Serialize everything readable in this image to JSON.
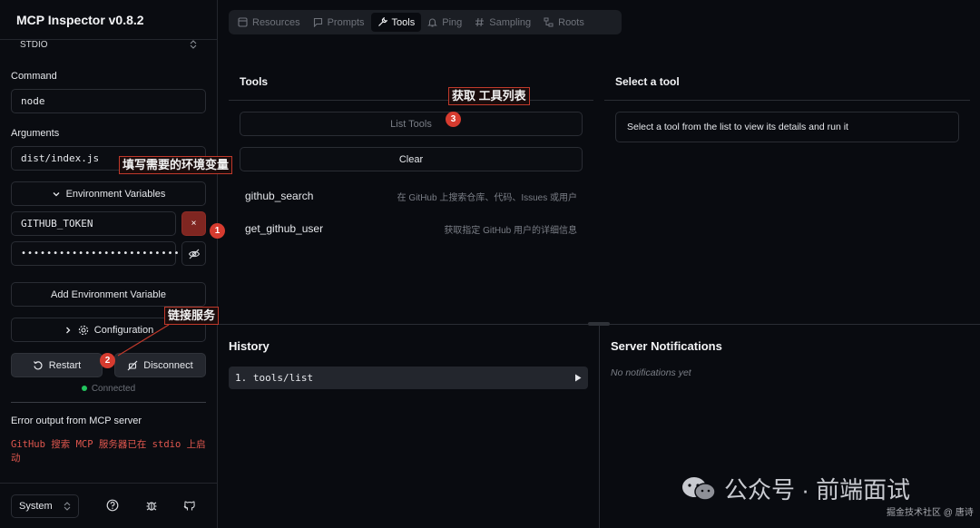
{
  "app": {
    "title": "MCP Inspector v0.8.2"
  },
  "sidebar": {
    "transport": "STDIO",
    "command_label": "Command",
    "command_value": "node",
    "arguments_label": "Arguments",
    "arguments_value": "dist/index.js",
    "env_toggle": "Environment Variables",
    "env_key": "GITHUB_TOKEN",
    "env_remove": "×",
    "env_value": "••••••••••••••••••••••••••••",
    "add_env": "Add Environment Variable",
    "configuration": "Configuration",
    "restart": "Restart",
    "disconnect": "Disconnect",
    "status": "Connected",
    "error_title": "Error output from MCP server",
    "error_text": "GitHub 搜索 MCP 服务器已在 stdio 上启动",
    "theme": "System"
  },
  "tabs": [
    {
      "label": "Resources",
      "icon": "resources-icon"
    },
    {
      "label": "Prompts",
      "icon": "prompts-icon"
    },
    {
      "label": "Tools",
      "icon": "tools-icon",
      "active": true
    },
    {
      "label": "Ping",
      "icon": "bell-icon"
    },
    {
      "label": "Sampling",
      "icon": "hash-icon"
    },
    {
      "label": "Roots",
      "icon": "roots-icon"
    }
  ],
  "tools_panel": {
    "title": "Tools",
    "list_button": "List Tools",
    "clear_button": "Clear",
    "tools": [
      {
        "name": "github_search",
        "description": "在 GitHub 上搜索仓库、代码、Issues 或用户"
      },
      {
        "name": "get_github_user",
        "description": "获取指定 GitHub 用户的详细信息"
      }
    ]
  },
  "detail_panel": {
    "title": "Select a tool",
    "hint": "Select a tool from the list to view its details and run it"
  },
  "history": {
    "title": "History",
    "items": [
      {
        "label": "1. tools/list"
      }
    ]
  },
  "notifications": {
    "title": "Server Notifications",
    "empty": "No notifications yet"
  },
  "annotations": {
    "env_note": "填写需要的环境变量",
    "connect_note": "链接服务",
    "list_note": "获取 工具列表",
    "badge1": "1",
    "badge2": "2",
    "badge3": "3"
  },
  "watermark": {
    "main": "公众号 · 前端面试",
    "sub": "掘金技术社区 @ 唐诗"
  },
  "colors": {
    "background": "#090b10",
    "error": "#e0574e",
    "danger": "#7f2621",
    "annotation": "#d63b2f",
    "connected": "#22c55e"
  }
}
